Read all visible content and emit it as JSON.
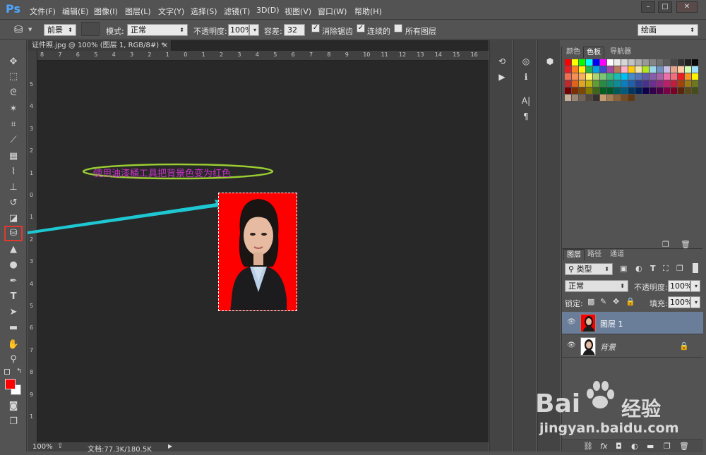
{
  "app": {
    "logo": "Ps"
  },
  "menu": [
    "文件(F)",
    "编辑(E)",
    "图像(I)",
    "图层(L)",
    "文字(Y)",
    "选择(S)",
    "滤镜(T)",
    "3D(D)",
    "视图(V)",
    "窗口(W)",
    "帮助(H)"
  ],
  "window_controls": {
    "minimize": "–",
    "restore": "□",
    "close": "✕"
  },
  "options": {
    "fill_source": "前景",
    "mode_label": "模式:",
    "mode_value": "正常",
    "opacity_label": "不透明度:",
    "opacity_value": "100%",
    "tolerance_label": "容差:",
    "tolerance_value": "32",
    "antialias_label": "消除锯齿",
    "contiguous_label": "连续的",
    "all_layers_label": "所有图层",
    "workspace": "绘画"
  },
  "document": {
    "tab_title": "证件照.jpg @ 100% (图层 1, RGB/8#) *",
    "tab_close": "×",
    "zoom": "100%",
    "doc_size": "文档:77.3K/180.5K",
    "annotation": "使用油漆桶工具把背景色变为红色",
    "ruler_h": [
      "8",
      "7",
      "6",
      "5",
      "4",
      "3",
      "2",
      "1",
      "0",
      "1",
      "2",
      "3",
      "4",
      "5",
      "6",
      "7",
      "8",
      "9",
      "10",
      "11",
      "12",
      "13",
      "14",
      "15",
      "16"
    ],
    "ruler_v": [
      "5",
      "4",
      "3",
      "2",
      "1",
      "0",
      "1",
      "2",
      "3",
      "4",
      "5",
      "6",
      "7",
      "8",
      "9",
      "1"
    ]
  },
  "panels": {
    "color_tabs": [
      "颜色",
      "色板",
      "导航器"
    ],
    "color_active": "色板",
    "layers_tabs": [
      "图层",
      "路径",
      "通道"
    ],
    "layers_active": "图层",
    "filter_kind": "类型",
    "blend_mode": "正常",
    "opacity_label": "不透明度:",
    "opacity_value": "100%",
    "lock_label": "锁定:",
    "fill_label": "填充:",
    "fill_value": "100%",
    "layers": [
      {
        "name": "图层 1",
        "selected": true,
        "locked": false
      },
      {
        "name": "背景",
        "selected": false,
        "locked": true
      }
    ]
  },
  "watermark": {
    "brand": "Bai",
    "brand2": "经验",
    "url": "jingyan.baidu.com"
  },
  "colors": {
    "accent_annotation": "#9acd32",
    "arrow": "#1ec8d2",
    "foreground": "#ff0000",
    "background": "#ffffff",
    "selected_layer": "#6a7d99"
  }
}
